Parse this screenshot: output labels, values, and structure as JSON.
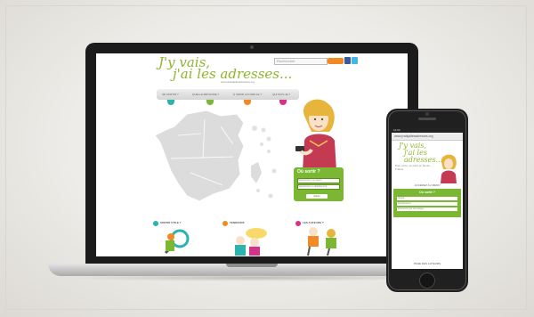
{
  "laptop_site": {
    "logo_line1": "J'y vais,",
    "logo_line2": "j'ai les adresses...",
    "tagline": "www.jlvaisjailesadresses.org",
    "search_placeholder": "Rechercher",
    "nav": [
      "SE SORTIR ?",
      "QUELLE MÉTHODE ?",
      "À VENIR LA FAMILLE ?",
      "QUI SUIS-JE ?"
    ],
    "login": {
      "title": "Où sortir ?",
      "field1": "Sélectionner une région",
      "field2": "Sélectionner un département",
      "button": "Valider"
    },
    "blocks": [
      {
        "title": "SORTIR UTILE ?",
        "color": "#2bb3b0"
      },
      {
        "title": "TENDANCE",
        "color": "#f08a24"
      },
      {
        "title": "LES AUTEURS ?",
        "color": "#d6328a"
      }
    ]
  },
  "phone_site": {
    "status": "12:34",
    "url": "www.jvaisjailesadresses.org",
    "logo_line1": "J'y vais,",
    "logo_line2": "j'ai les adresses...",
    "tagline": "Pour sortir, se sortir en Île-de-France",
    "menu_label": "ACCÉDEZ AU MENU",
    "form_title": "Où sortir ?",
    "field1": "Région",
    "field2": "Département",
    "field3": "Recherche par thématique",
    "footer": "PAGE DES AUTEURS"
  },
  "colors": {
    "brand_green": "#8db52e",
    "form_green": "#7bb733",
    "accent_orange": "#f08a24",
    "accent_teal": "#2bb3b0",
    "accent_pink": "#d6328a"
  }
}
